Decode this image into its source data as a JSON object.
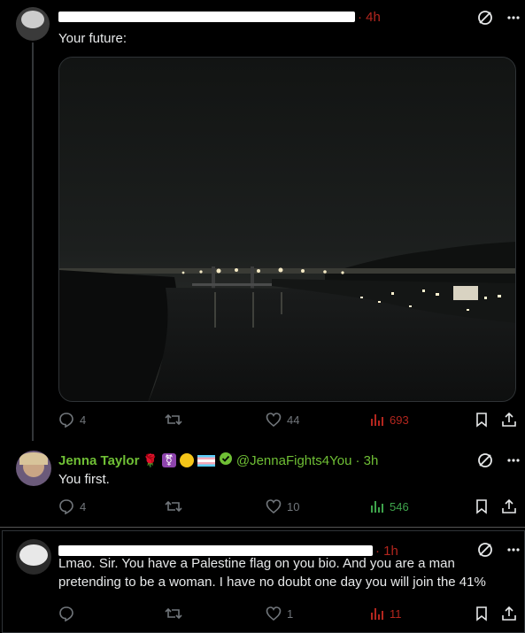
{
  "post1": {
    "time": "· 4h",
    "text": "Your future:",
    "actions": {
      "replies": "4",
      "reposts": "",
      "likes": "44",
      "views": "693"
    }
  },
  "post2": {
    "name": "Jenna Taylor",
    "handle": "@JennaFights4You",
    "time": "· 3h",
    "text": "You first.",
    "actions": {
      "replies": "4",
      "reposts": "",
      "likes": "10",
      "views": "546"
    }
  },
  "post3": {
    "time": "· 1h",
    "text_line1": "Lmao. Sir. You have a Palestine flag on you bio. And you are a man",
    "text_line2": "pretending to be a woman. I have no doubt one day you will join the  41%",
    "actions": {
      "replies": "",
      "reposts": "",
      "likes": "1",
      "views": "11"
    }
  },
  "colors": {
    "accent_green": "#6fbf35",
    "views_red": "#b3261e",
    "views_green": "#3ea34b",
    "muted": "#71767b"
  }
}
